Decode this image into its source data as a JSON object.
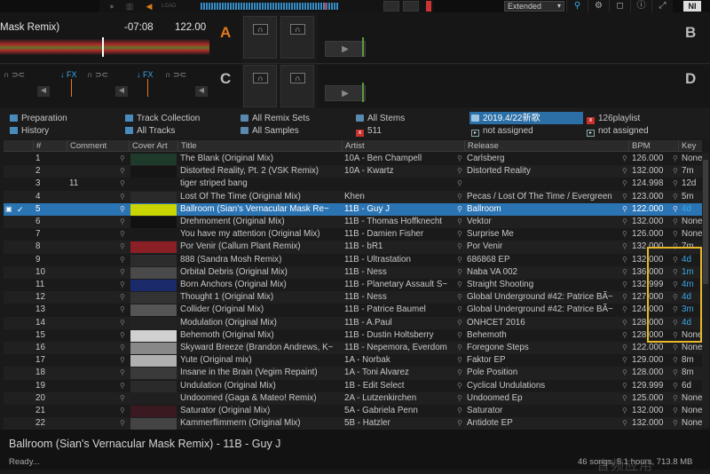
{
  "topbar": {
    "layout_select": "Extended",
    "logo": "NI",
    "icons": [
      "magnifier-icon",
      "gear-icon",
      "info-icon",
      "fullscreen-icon"
    ]
  },
  "deckA": {
    "title": "Mask Remix)",
    "time": "-07:08",
    "bpm": "122.00",
    "letter": "A"
  },
  "deckB": {
    "letter": "B"
  },
  "deckC": {
    "letter": "C",
    "fx1": "FX",
    "fx2": "FX"
  },
  "deckD": {
    "letter": "D"
  },
  "colors": {
    "accent": "#e07a1a",
    "selection": "#2b74b3",
    "key_blue": "#3aa7e6"
  },
  "tree": [
    {
      "label": "Preparation",
      "icon": "list-icon"
    },
    {
      "label": "History",
      "icon": "history-icon"
    },
    {
      "label": "Track Collection",
      "icon": "collection-icon"
    },
    {
      "label": "All Tracks",
      "icon": "tracks-icon"
    },
    {
      "label": "All Remix Sets",
      "icon": "folder-icon"
    },
    {
      "label": "All Samples",
      "icon": "folder-icon"
    },
    {
      "label": "All Stems",
      "icon": "folder-icon"
    },
    {
      "label": "511",
      "icon": "playlist-red-icon"
    },
    {
      "label": "2019.4/22新歌",
      "icon": "folder-icon"
    },
    {
      "label": "not assigned",
      "icon": "play-icon"
    },
    {
      "label": "126playlist",
      "icon": "playlist-red-icon"
    },
    {
      "label": "not assigned",
      "icon": "play-icon"
    }
  ],
  "columns": [
    "#",
    "Comment",
    "Cover Art",
    "Title",
    "Artist",
    "Release",
    "BPM",
    "Key"
  ],
  "rows": [
    {
      "n": "1",
      "comment": "",
      "title": "The Blank (Original Mix)",
      "artist": "10A - Ben Champell",
      "release": "Carlsberg",
      "bpm": "126.000",
      "key": "None",
      "cover": "#1d3a2a"
    },
    {
      "n": "2",
      "comment": "",
      "title": "Distorted Reality, Pt. 2 (VSK Remix)",
      "artist": "10A - Kwartz",
      "release": "Distorted Reality",
      "bpm": "132.000",
      "key": "7m",
      "cover": "#151515"
    },
    {
      "n": "3",
      "comment": "11",
      "title": "tiger striped bang",
      "artist": "",
      "release": "",
      "bpm": "124.998",
      "key": "12d",
      "cover": ""
    },
    {
      "n": "4",
      "comment": "",
      "title": "Lost Of The Time (Original Mix)",
      "artist": "Khen",
      "release": "Pecas / Lost Of The Time / Evergreen",
      "bpm": "123.000",
      "key": "5m",
      "cover": "#2a2a2a"
    },
    {
      "n": "5",
      "comment": "",
      "title": "Ballroom (Sian's Vernacular Mask Re~",
      "artist": "11B - Guy J",
      "release": "Ballroom",
      "bpm": "122.000",
      "key": "4d",
      "cover": "#c9d400",
      "sel": true
    },
    {
      "n": "6",
      "comment": "",
      "title": "Drehmoment (Original Mix)",
      "artist": "11B - Thomas Hoffknecht",
      "release": "Vektor",
      "bpm": "132.000",
      "key": "None",
      "cover": "#111111"
    },
    {
      "n": "7",
      "comment": "",
      "title": "You have my attention (Original Mix)",
      "artist": "11B - Damien Fisher",
      "release": "Surprise Me",
      "bpm": "126.000",
      "key": "None",
      "cover": "#1a1a1a"
    },
    {
      "n": "8",
      "comment": "",
      "title": "Por Venir (Callum Plant Remix)",
      "artist": "11B - bR1",
      "release": "Por Venir",
      "bpm": "132.000",
      "key": "7m",
      "cover": "#8a1f25"
    },
    {
      "n": "9",
      "comment": "",
      "title": "888 (Sandra Mosh Remix)",
      "artist": "11B - Ultrastation",
      "release": "686868 EP",
      "bpm": "132.000",
      "key": "4d",
      "cover": "#2c2c2c"
    },
    {
      "n": "10",
      "comment": "",
      "title": "Orbital Debris (Original Mix)",
      "artist": "11B - Ness",
      "release": "Naba VA 002",
      "bpm": "136.000",
      "key": "1m",
      "cover": "#4a4a4a"
    },
    {
      "n": "11",
      "comment": "",
      "title": "Born Anchors (Original Mix)",
      "artist": "11B - Planetary Assault S~",
      "release": "Straight Shooting",
      "bpm": "132.999",
      "key": "4m",
      "cover": "#1a2a6a"
    },
    {
      "n": "12",
      "comment": "",
      "title": "Thought 1 (Original Mix)",
      "artist": "11B - Ness",
      "release": "Global Underground #42: Patrice BÃ~",
      "bpm": "127.000",
      "key": "4d",
      "cover": "#333333"
    },
    {
      "n": "13",
      "comment": "",
      "title": "Collider (Original Mix)",
      "artist": "11B - Patrice Baumel",
      "release": "Global Underground #42: Patrice BÃ~",
      "bpm": "124.000",
      "key": "3m",
      "cover": "#555555"
    },
    {
      "n": "14",
      "comment": "",
      "title": "Modulation (Original Mix)",
      "artist": "11B - A.Paul",
      "release": "ONHCET 2016",
      "bpm": "128.000",
      "key": "4d",
      "cover": "#222222"
    },
    {
      "n": "15",
      "comment": "",
      "title": "Behemoth (Original Mix)",
      "artist": "11B - Dustin Holtsberry",
      "release": "Behemoth",
      "bpm": "128.000",
      "key": "None",
      "cover": "#d0d0d0"
    },
    {
      "n": "16",
      "comment": "",
      "title": "Skyward Breeze (Brandon Andrews, K~",
      "artist": "11B - Nepemora, Everdom",
      "release": "Foregone Steps",
      "bpm": "122.000",
      "key": "None",
      "cover": "#888888"
    },
    {
      "n": "17",
      "comment": "",
      "title": "Yute (Original mix)",
      "artist": "1A - Norbak",
      "release": "Faktor EP",
      "bpm": "129.000",
      "key": "8m",
      "cover": "#b0b0b0"
    },
    {
      "n": "18",
      "comment": "",
      "title": "Insane in the Brain (Vegim Repaint)",
      "artist": "1A - Toni Alvarez",
      "release": "Pole Position",
      "bpm": "128.000",
      "key": "8m",
      "cover": "#3a3a3a"
    },
    {
      "n": "19",
      "comment": "",
      "title": "Undulation (Original Mix)",
      "artist": "1B - Edit Select",
      "release": "Cyclical Undulations",
      "bpm": "129.999",
      "key": "6d",
      "cover": "#2a2a2a"
    },
    {
      "n": "20",
      "comment": "",
      "title": "Undoomed (Gaga & Mateo! Remix)",
      "artist": "2A - Lutzenkirchen",
      "release": "Undoomed Ep",
      "bpm": "125.000",
      "key": "None",
      "cover": "#202020"
    },
    {
      "n": "21",
      "comment": "",
      "title": "Saturator (Original Mix)",
      "artist": "5A - Gabriela Penn",
      "release": "Saturator",
      "bpm": "132.000",
      "key": "None",
      "cover": "#3a1a20"
    },
    {
      "n": "22",
      "comment": "",
      "title": "Kammerflimmern (Original Mix)",
      "artist": "5B - Hatzler",
      "release": "Antidote EP",
      "bpm": "132.000",
      "key": "None",
      "cover": "#444444"
    }
  ],
  "now_playing": "Ballroom (Sian's Vernacular Mask Remix) - 11B - Guy J",
  "status": "Ready...",
  "summary": "46 songs, 5.1 hours, 713.8 MB",
  "watermark": "音频应用"
}
